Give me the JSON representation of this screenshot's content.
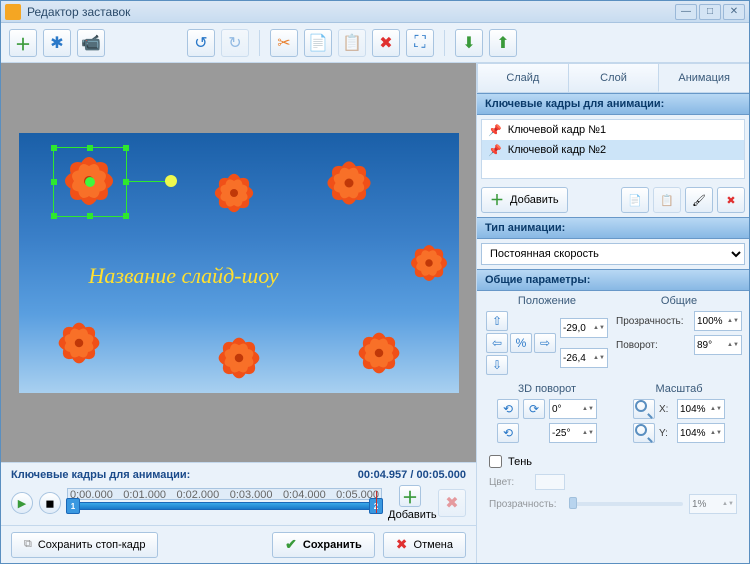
{
  "window": {
    "title": "Редактор заставок"
  },
  "tabs": {
    "slide": "Слайд",
    "layer": "Слой",
    "anim": "Анимация"
  },
  "keyframes": {
    "header": "Ключевые кадры для анимации:",
    "items": [
      "Ключевой кадр №1",
      "Ключевой кадр №2"
    ],
    "add": "Добавить"
  },
  "anim_type": {
    "header": "Тип анимации:",
    "value": "Постоянная скорость"
  },
  "params": {
    "header": "Общие параметры:",
    "position": "Положение",
    "general": "Общие",
    "rotation3d": "3D поворот",
    "scale": "Масштаб",
    "x": "-29,0",
    "y": "-26,4",
    "opacity_lbl": "Прозрачность:",
    "opacity": "100%",
    "rotate_lbl": "Поворот:",
    "rotate": "89°",
    "r3d_a": "0°",
    "r3d_b": "-25°",
    "scale_x_lbl": "X:",
    "scale_x": "104%",
    "scale_y_lbl": "Y:",
    "scale_y": "104%",
    "shadow": "Тень",
    "color_lbl": "Цвет:",
    "shadow_op": "1%"
  },
  "timeline": {
    "header": "Ключевые кадры для анимации:",
    "time": "00:04.957 / 00:05.000",
    "ticks": [
      "0:00.000",
      "0:01.000",
      "0:02.000",
      "0:03.000",
      "0:04.000",
      "0:05.000"
    ],
    "add": "Добавить"
  },
  "canvas": {
    "caption": "Название слайд-шоу"
  },
  "footer": {
    "snapshot": "Сохранить стоп-кадр",
    "save": "Сохранить",
    "cancel": "Отмена"
  }
}
